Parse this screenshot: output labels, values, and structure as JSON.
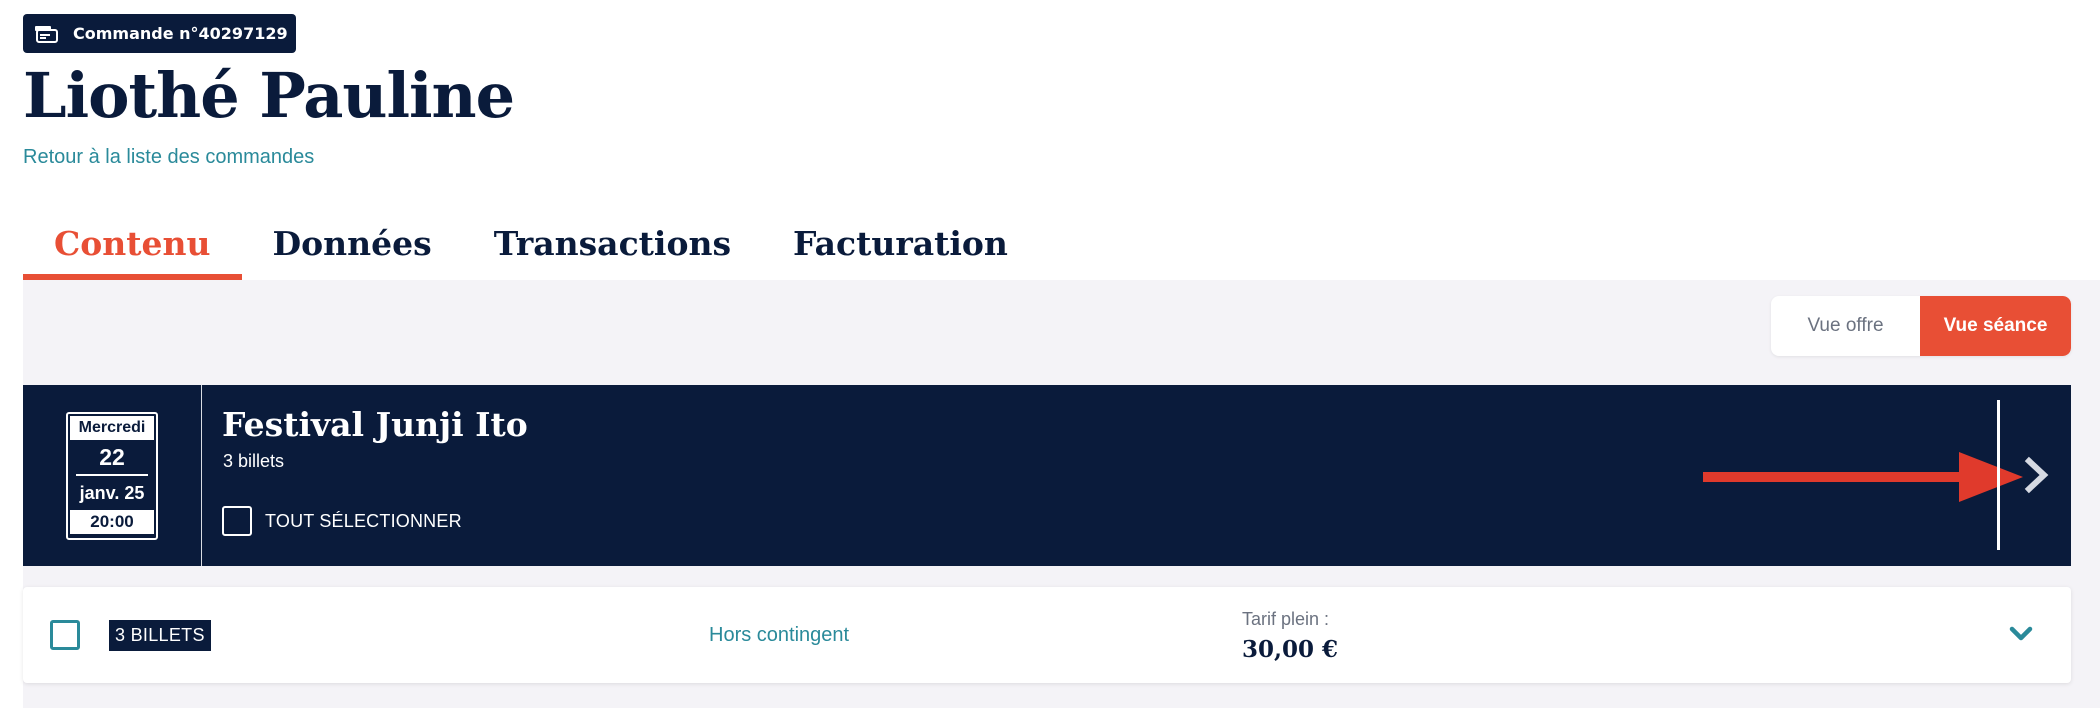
{
  "header": {
    "order_badge": "Commande n°40297129",
    "customer_name": "Liothé Pauline",
    "back_link": "Retour à la liste des commandes"
  },
  "tabs": [
    {
      "label": "Contenu",
      "active": true
    },
    {
      "label": "Données",
      "active": false
    },
    {
      "label": "Transactions",
      "active": false
    },
    {
      "label": "Facturation",
      "active": false
    }
  ],
  "view_toggle": {
    "offer_label": "Vue offre",
    "session_label": "Vue séance",
    "selected": "session"
  },
  "event": {
    "date": {
      "weekday": "Mercredi",
      "day": "22",
      "month_year": "janv. 25",
      "time": "20:00"
    },
    "title": "Festival Junji Ito",
    "ticket_count": "3 billets",
    "select_all_label": "TOUT SÉLECTIONNER"
  },
  "ticket_row": {
    "badge": "3 BILLETS",
    "quota": "Hors contingent",
    "price_label": "Tarif plein :",
    "price_value": "30,00 €"
  },
  "colors": {
    "navy": "#0a1b3b",
    "accent": "#e84f35",
    "teal": "#2a8a9a",
    "background": "#f4f3f7"
  },
  "icons": {
    "order_badge": "ticket-register-icon",
    "event_expand": "chevron-right-icon",
    "row_expand": "chevron-down-icon",
    "annotation": "red-arrow-icon"
  }
}
